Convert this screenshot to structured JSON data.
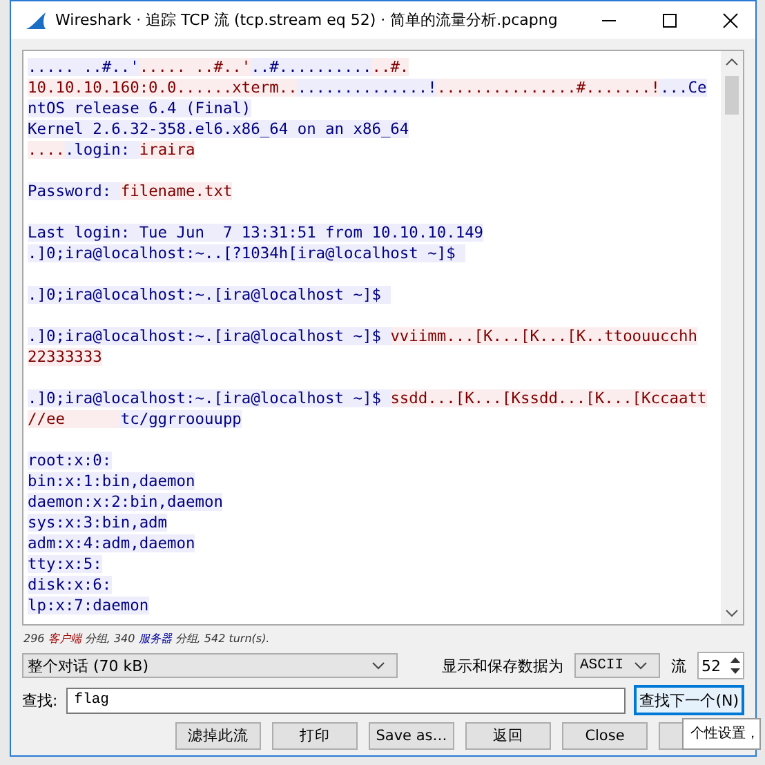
{
  "window": {
    "title": "Wireshark · 追踪 TCP 流 (tcp.stream eq 52) · 简单的流量分析.pcapng"
  },
  "stream_lines": [
    {
      "kind": "text",
      "segments": [
        {
          "kind": "server",
          "text": "..... ..#..'"
        },
        {
          "kind": "client",
          "text": "..... ..#..'"
        },
        {
          "kind": "server",
          "text": "..#.........."
        },
        {
          "kind": "client",
          "text": "..#."
        }
      ]
    },
    {
      "kind": "text",
      "segments": [
        {
          "kind": "client",
          "text": "10.10.10.160:0.0......xterm.."
        },
        {
          "kind": "server",
          "text": "..............!"
        },
        {
          "kind": "client",
          "text": "...............#.......!"
        },
        {
          "kind": "server",
          "text": "...Ce"
        }
      ]
    },
    {
      "kind": "text",
      "segments": [
        {
          "kind": "server",
          "text": "ntOS release 6.4 (Final)"
        }
      ]
    },
    {
      "kind": "text",
      "segments": [
        {
          "kind": "server",
          "text": "Kernel 2.6.32-358.el6.x86_64 on an x86_64"
        }
      ]
    },
    {
      "kind": "text",
      "segments": [
        {
          "kind": "client",
          "text": "...."
        },
        {
          "kind": "server",
          "text": ".login: "
        },
        {
          "kind": "client",
          "text": "iraira"
        }
      ]
    },
    {
      "kind": "blank"
    },
    {
      "kind": "text",
      "segments": [
        {
          "kind": "server",
          "text": "Password: "
        },
        {
          "kind": "client",
          "text": "filename.txt"
        }
      ]
    },
    {
      "kind": "blank"
    },
    {
      "kind": "text",
      "segments": [
        {
          "kind": "server",
          "text": "Last login: Tue Jun  7 13:31:51 from 10.10.10.149"
        }
      ]
    },
    {
      "kind": "text",
      "segments": [
        {
          "kind": "server",
          "text": ".]0;ira@localhost:~..[?1034h[ira@localhost ~]$ "
        }
      ]
    },
    {
      "kind": "blank"
    },
    {
      "kind": "text",
      "segments": [
        {
          "kind": "server",
          "text": ".]0;ira@localhost:~.[ira@localhost ~]$ "
        }
      ]
    },
    {
      "kind": "blank"
    },
    {
      "kind": "text",
      "segments": [
        {
          "kind": "server",
          "text": ".]0;ira@localhost:~.[ira@localhost ~]$ "
        },
        {
          "kind": "client",
          "text": "vviimm...[K...[K...[K..ttoouucchh"
        }
      ]
    },
    {
      "kind": "text",
      "segments": [
        {
          "kind": "client",
          "text": "22333333"
        }
      ]
    },
    {
      "kind": "blank"
    },
    {
      "kind": "text",
      "segments": [
        {
          "kind": "server",
          "text": ".]0;ira@localhost:~.[ira@localhost ~]$ "
        },
        {
          "kind": "client",
          "text": "ssdd...[K...[Kssdd...[K...[Kccaatt"
        }
      ]
    },
    {
      "kind": "text",
      "segments": [
        {
          "kind": "client",
          "text": "//ee      "
        },
        {
          "kind": "server",
          "text": "tc/ggrroouupp"
        }
      ]
    },
    {
      "kind": "blank"
    },
    {
      "kind": "text",
      "segments": [
        {
          "kind": "server",
          "text": "root:x:0:"
        }
      ]
    },
    {
      "kind": "text",
      "segments": [
        {
          "kind": "server",
          "text": "bin:x:1:bin,daemon"
        }
      ]
    },
    {
      "kind": "text",
      "segments": [
        {
          "kind": "server",
          "text": "daemon:x:2:bin,daemon"
        }
      ]
    },
    {
      "kind": "text",
      "segments": [
        {
          "kind": "server",
          "text": "sys:x:3:bin,adm"
        }
      ]
    },
    {
      "kind": "text",
      "segments": [
        {
          "kind": "server",
          "text": "adm:x:4:adm,daemon"
        }
      ]
    },
    {
      "kind": "text",
      "segments": [
        {
          "kind": "server",
          "text": "tty:x:5:"
        }
      ]
    },
    {
      "kind": "text",
      "segments": [
        {
          "kind": "server",
          "text": "disk:x:6:"
        }
      ]
    },
    {
      "kind": "text",
      "segments": [
        {
          "kind": "server",
          "text": "lp:x:7:daemon"
        }
      ]
    }
  ],
  "summary": [
    {
      "kind": "plain",
      "text": "296 "
    },
    {
      "kind": "client",
      "text": "客户端"
    },
    {
      "kind": "plain",
      "text": " 分组, 340 "
    },
    {
      "kind": "server",
      "text": "服务器"
    },
    {
      "kind": "plain",
      "text": " 分组, 542 turn(s)."
    }
  ],
  "conversation_select": {
    "value": "整个对话 (70 kB)"
  },
  "format_label": "显示和保存数据为",
  "format_select": {
    "value": "ASCII"
  },
  "stream_label": "流",
  "stream_spin": {
    "value": "52"
  },
  "find_label": "查找:",
  "find_field": {
    "value": "flag"
  },
  "find_next_button": "查找下一个(N)",
  "buttons": [
    "滤掉此流",
    "打印",
    "Save as…",
    "返回",
    "Close"
  ],
  "tooltip": "个性设置，"
}
